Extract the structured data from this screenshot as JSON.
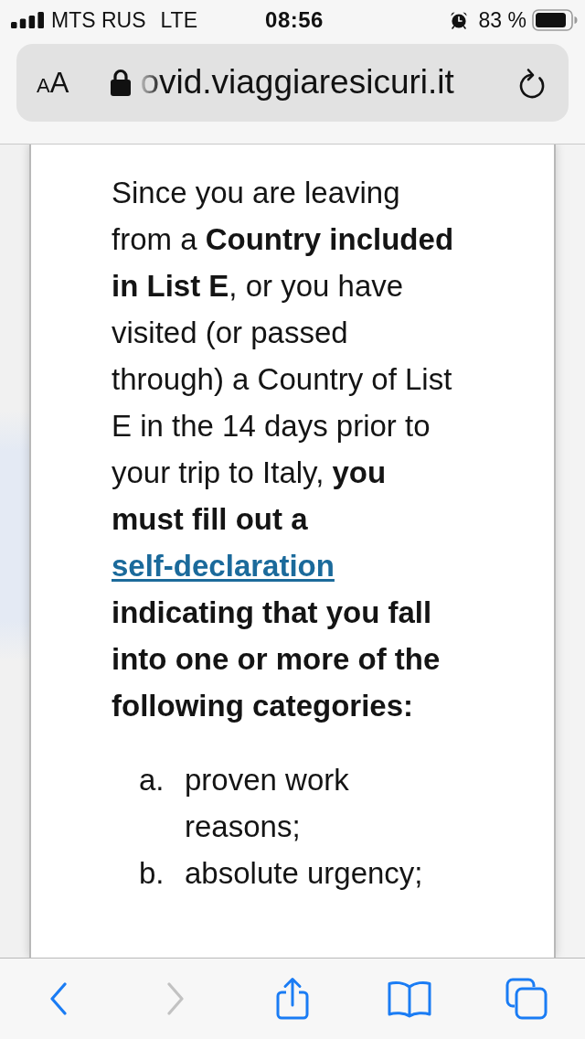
{
  "status_bar": {
    "carrier": "MTS RUS",
    "network": "LTE",
    "time": "08:56",
    "alarm": true,
    "battery": "83 %"
  },
  "address_bar": {
    "reader_button": "AA",
    "secure": true,
    "url": "ovid.viaggiaresicuri.it"
  },
  "article": {
    "paragraph": [
      {
        "kind": "text",
        "text": "Since you are leaving from a **Country included in List E**, or you have visited (or passed through) a Country of List E in the 14 days prior to your trip to Italy, **you must fill out a**"
      },
      {
        "kind": "link",
        "text": "self-declaration"
      },
      {
        "kind": "text",
        "text": "**indicating that you fall into one or more of the following categories:**"
      }
    ],
    "list": [
      {
        "marker": "a.",
        "text": "proven work reasons;"
      },
      {
        "marker": "b.",
        "text": "absolute urgency;"
      }
    ]
  },
  "toolbar": [
    {
      "kind": "back",
      "disabled": false
    },
    {
      "kind": "forward",
      "disabled": true
    },
    {
      "kind": "share",
      "disabled": false
    },
    {
      "kind": "bookmarks",
      "disabled": false
    },
    {
      "kind": "tabs",
      "disabled": false
    }
  ]
}
